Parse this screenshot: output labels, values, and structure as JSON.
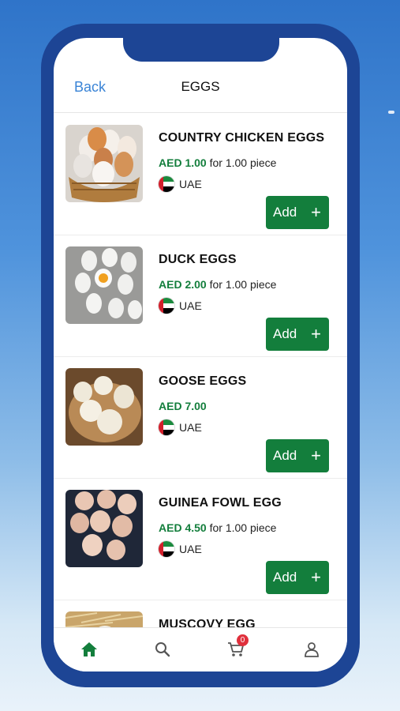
{
  "header": {
    "back_label": "Back",
    "title": "EGGS"
  },
  "products": [
    {
      "name": "COUNTRY CHICKEN EGGS",
      "price": "AED 1.00",
      "unit": " for 1.00 piece",
      "country": "UAE",
      "add_label": "Add",
      "image": "eggs-in-basket"
    },
    {
      "name": "DUCK EGGS",
      "price": "AED 2.00",
      "unit": " for 1.00 piece",
      "country": "UAE",
      "add_label": "Add",
      "image": "duck-eggs-with-yolk"
    },
    {
      "name": "GOOSE EGGS",
      "price": "AED 7.00",
      "unit": "",
      "country": "UAE",
      "add_label": "Add",
      "image": "goose-eggs-in-bowl"
    },
    {
      "name": "GUINEA FOWL EGG",
      "price": "AED 4.50",
      "unit": " for 1.00 piece",
      "country": "UAE",
      "add_label": "Add",
      "image": "guinea-fowl-eggs"
    },
    {
      "name": "MUSCOVY EGG",
      "price": "",
      "unit": "",
      "country": "",
      "add_label": "",
      "image": "muscovy-eggs-on-straw"
    }
  ],
  "tabbar": {
    "items": [
      "home-icon",
      "search-icon",
      "cart-icon",
      "profile-icon"
    ],
    "cart_count": "0",
    "active": "home"
  },
  "colors": {
    "accent_green": "#137e3c",
    "phone_frame": "#1d4595",
    "back_link": "#3a84d6",
    "badge": "#e0303c"
  }
}
